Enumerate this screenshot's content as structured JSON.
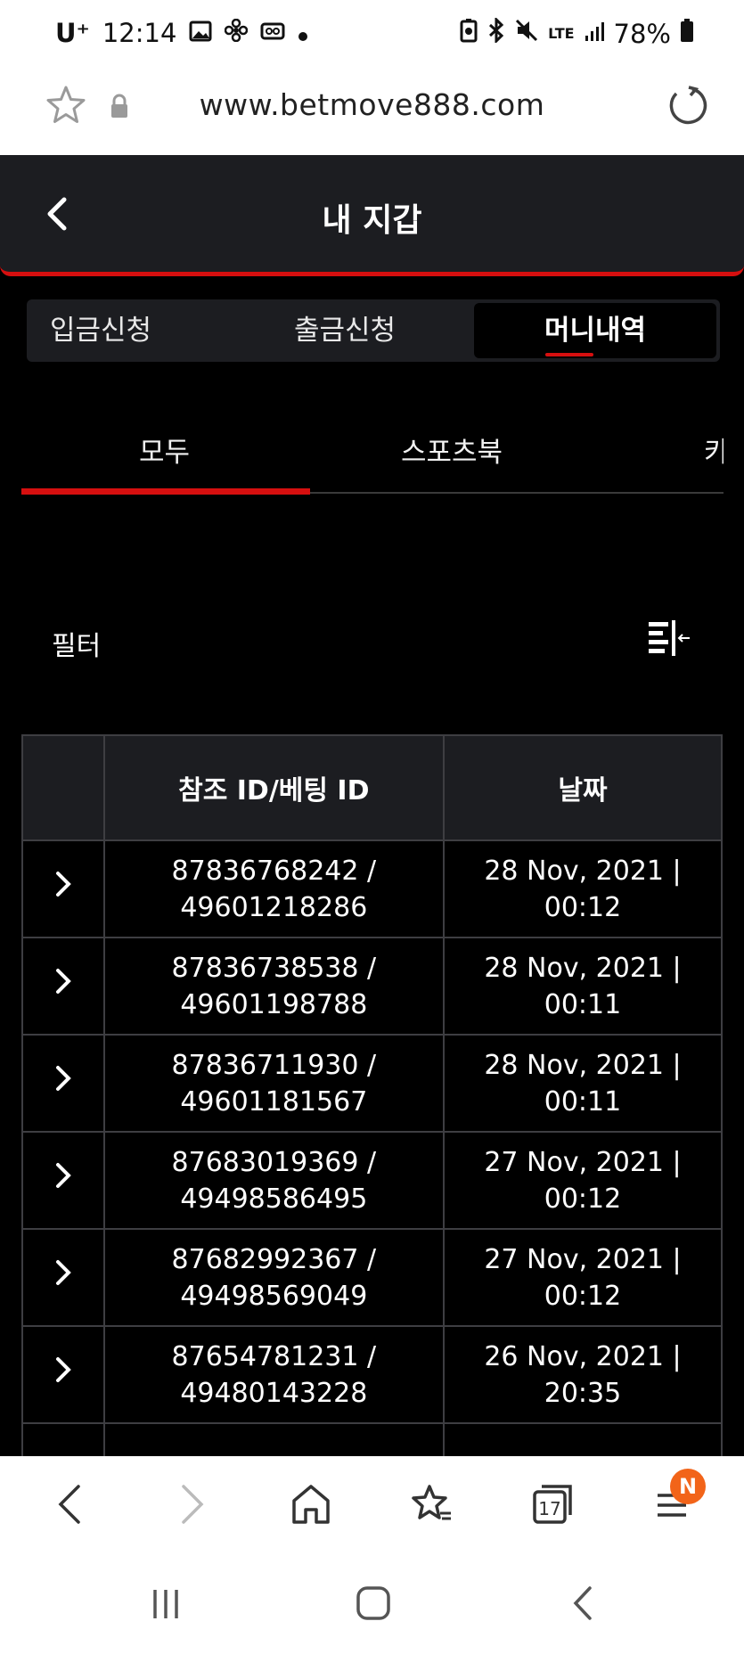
{
  "status_bar": {
    "carrier": "U⁺",
    "time": "12:14",
    "network": "LTE",
    "battery": "78%"
  },
  "browser": {
    "url": "www.betmove888.com",
    "tabs_count": "17",
    "menu_badge": "N"
  },
  "header": {
    "title": "내 지갑"
  },
  "wallet_tabs": {
    "deposit": "입금신청",
    "withdraw": "출금신청",
    "history": "머니내역"
  },
  "category_tabs": {
    "all": "모두",
    "sportsbook": "스포츠북",
    "third": "카"
  },
  "filter": {
    "label": "필터"
  },
  "table": {
    "headers": [
      "",
      "참조 ID/베팅 ID",
      "날짜"
    ],
    "rows": [
      {
        "ref": "87836768242 /",
        "bet": "49601218286",
        "date": "28 Nov, 2021 |",
        "time": "00:12"
      },
      {
        "ref": "87836738538 /",
        "bet": "49601198788",
        "date": "28 Nov, 2021 |",
        "time": "00:11"
      },
      {
        "ref": "87836711930 /",
        "bet": "49601181567",
        "date": "28 Nov, 2021 |",
        "time": "00:11"
      },
      {
        "ref": "87683019369 /",
        "bet": "49498586495",
        "date": "27 Nov, 2021 |",
        "time": "00:12"
      },
      {
        "ref": "87682992367 /",
        "bet": "49498569049",
        "date": "27 Nov, 2021 |",
        "time": "00:12"
      },
      {
        "ref": "87654781231 /",
        "bet": "49480143228",
        "date": "26 Nov, 2021 |",
        "time": "20:35"
      }
    ]
  }
}
